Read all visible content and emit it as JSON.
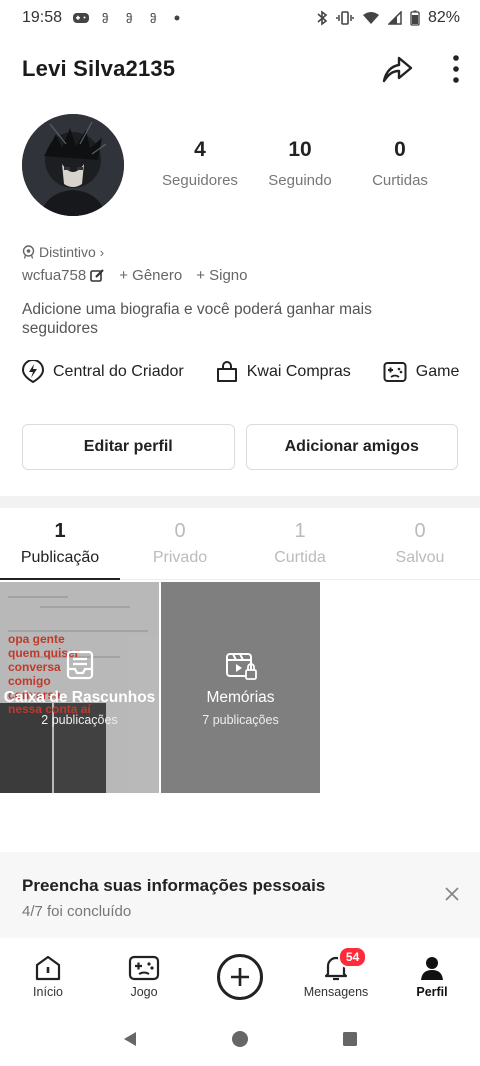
{
  "status_bar": {
    "time": "19:58",
    "battery": "82%"
  },
  "header": {
    "username": "Levi Silva2135"
  },
  "stats": [
    {
      "value": "4",
      "label": "Seguidores"
    },
    {
      "value": "10",
      "label": "Seguindo"
    },
    {
      "value": "0",
      "label": "Curtidas"
    }
  ],
  "profile": {
    "badge_label": "Distintivo",
    "user_id": "wcfua758",
    "gender_label": "+ Gênero",
    "sign_label": "+ Signo",
    "bio_placeholder": "Adicione uma biografia e você poderá ganhar mais seguidores"
  },
  "shortcuts": [
    {
      "label": "Central do Criador",
      "icon": "lightning-circle-icon"
    },
    {
      "label": "Kwai Compras",
      "icon": "shopping-bag-icon"
    },
    {
      "label": "Game",
      "icon": "gamepad-icon"
    }
  ],
  "buttons": {
    "edit_profile": "Editar perfil",
    "add_friends": "Adicionar amigos"
  },
  "tabs": [
    {
      "count": "1",
      "label": "Publicação",
      "active": true
    },
    {
      "count": "0",
      "label": "Privado",
      "active": false
    },
    {
      "count": "1",
      "label": "Curtida",
      "active": false
    },
    {
      "count": "0",
      "label": "Salvou",
      "active": false
    }
  ],
  "grid": {
    "drafts": {
      "title": "Caixa de Rascunhos",
      "subtitle": "2 publicações",
      "overlay_text": "opa gente quem quiser conversa comigo conversa nessa conta aí"
    },
    "memories": {
      "title": "Memórias",
      "subtitle": "7 publicações"
    }
  },
  "info_card": {
    "title": "Preencha suas informações pessoais",
    "progress": "4/7 foi concluído"
  },
  "bottom_nav": [
    {
      "label": "Início",
      "icon": "home-icon"
    },
    {
      "label": "Jogo",
      "icon": "gamepad-icon"
    },
    {
      "label": "",
      "icon": "plus-circle-icon"
    },
    {
      "label": "Mensagens",
      "icon": "bell-icon",
      "badge": "54"
    },
    {
      "label": "Perfil",
      "icon": "person-icon",
      "active": true
    }
  ],
  "colors": {
    "badge_red": "#ff2b3b",
    "text_primary": "#222222",
    "text_secondary": "#777777"
  }
}
